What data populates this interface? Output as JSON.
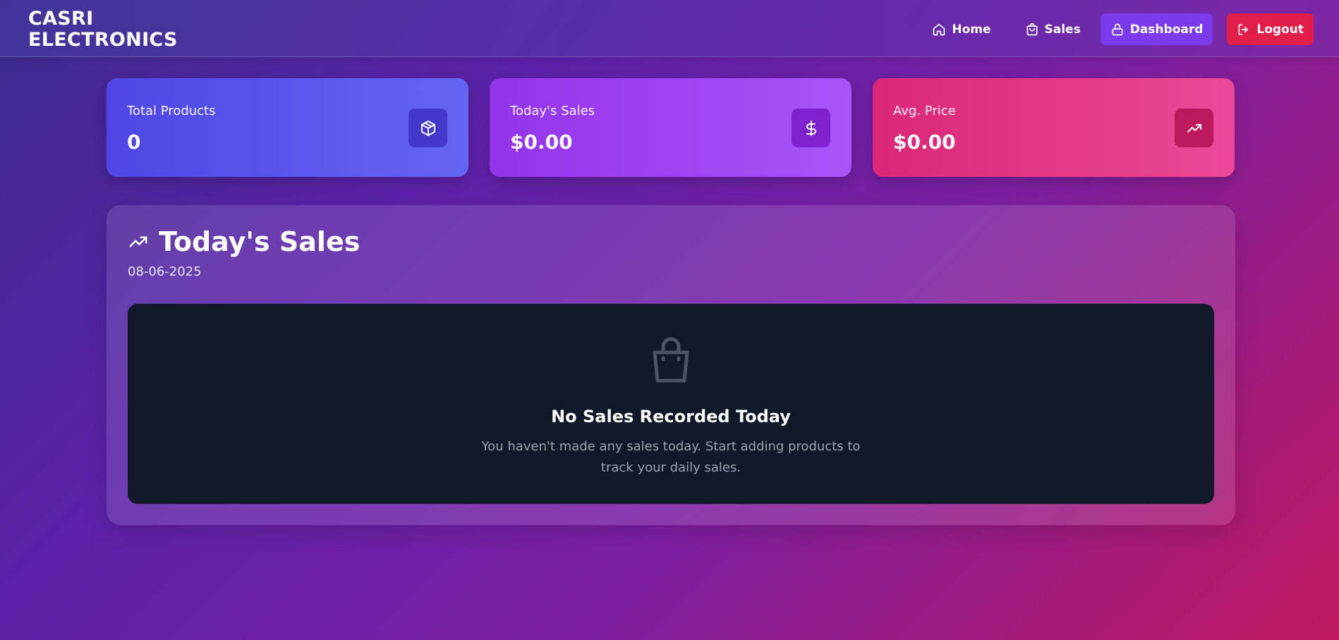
{
  "brand": {
    "line1": "CASRI",
    "line2": "ELECTRONICS"
  },
  "nav": [
    {
      "label": "Home",
      "icon": "home-icon"
    },
    {
      "label": "Sales",
      "icon": "shopping-bag-icon"
    },
    {
      "label": "Dashboard",
      "icon": "lock-icon",
      "active": true
    },
    {
      "label": "Logout",
      "icon": "logout-icon"
    }
  ],
  "stats": [
    {
      "label": "Total Products",
      "value": "0",
      "icon": "package-icon",
      "color": "#4f46e5"
    },
    {
      "label": "Today's Sales",
      "value": "$0.00",
      "icon": "dollar-icon",
      "color": "#9333ea"
    },
    {
      "label": "Avg. Price",
      "value": "$0.00",
      "icon": "trending-up-icon",
      "color": "#db2777"
    }
  ],
  "panel": {
    "title": "Today's Sales",
    "date": "08-06-2025",
    "empty_title": "No Sales Recorded Today",
    "empty_text": "You haven't made any sales today. Start adding products to track your daily sales."
  }
}
